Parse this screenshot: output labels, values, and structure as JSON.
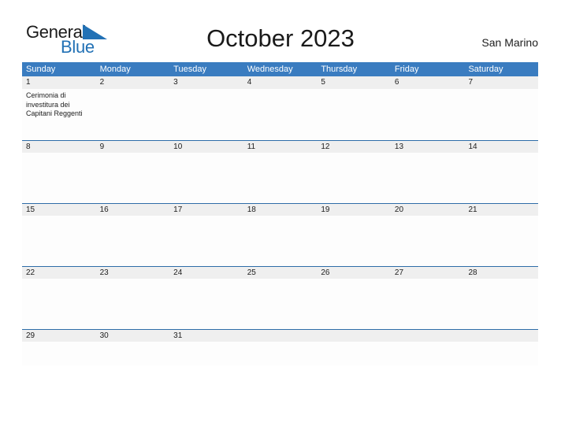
{
  "brand": {
    "name_part1": "General",
    "name_part2": "Blue",
    "logo_icon": "blue-flag-triangle-icon",
    "color_dark": "#1b1b1b",
    "color_blue": "#2271b5"
  },
  "header": {
    "title": "October 2023",
    "location": "San Marino"
  },
  "theme": {
    "header_bar_color": "#3a7cc0",
    "date_band_color": "#efefef",
    "row_divider_color": "#2e6da8",
    "cell_background": "#fdfdfd",
    "text_color": "#202020"
  },
  "calendar": {
    "month": "October",
    "year": "2023",
    "weekday_headers": [
      "Sunday",
      "Monday",
      "Tuesday",
      "Wednesday",
      "Thursday",
      "Friday",
      "Saturday"
    ],
    "weeks": [
      {
        "days": [
          {
            "num": "1",
            "event": "Cerimonia di investitura dei Capitani Reggenti"
          },
          {
            "num": "2",
            "event": ""
          },
          {
            "num": "3",
            "event": ""
          },
          {
            "num": "4",
            "event": ""
          },
          {
            "num": "5",
            "event": ""
          },
          {
            "num": "6",
            "event": ""
          },
          {
            "num": "7",
            "event": ""
          }
        ]
      },
      {
        "days": [
          {
            "num": "8",
            "event": ""
          },
          {
            "num": "9",
            "event": ""
          },
          {
            "num": "10",
            "event": ""
          },
          {
            "num": "11",
            "event": ""
          },
          {
            "num": "12",
            "event": ""
          },
          {
            "num": "13",
            "event": ""
          },
          {
            "num": "14",
            "event": ""
          }
        ]
      },
      {
        "days": [
          {
            "num": "15",
            "event": ""
          },
          {
            "num": "16",
            "event": ""
          },
          {
            "num": "17",
            "event": ""
          },
          {
            "num": "18",
            "event": ""
          },
          {
            "num": "19",
            "event": ""
          },
          {
            "num": "20",
            "event": ""
          },
          {
            "num": "21",
            "event": ""
          }
        ]
      },
      {
        "days": [
          {
            "num": "22",
            "event": ""
          },
          {
            "num": "23",
            "event": ""
          },
          {
            "num": "24",
            "event": ""
          },
          {
            "num": "25",
            "event": ""
          },
          {
            "num": "26",
            "event": ""
          },
          {
            "num": "27",
            "event": ""
          },
          {
            "num": "28",
            "event": ""
          }
        ]
      },
      {
        "days": [
          {
            "num": "29",
            "event": ""
          },
          {
            "num": "30",
            "event": ""
          },
          {
            "num": "31",
            "event": ""
          },
          {
            "num": "",
            "event": ""
          },
          {
            "num": "",
            "event": ""
          },
          {
            "num": "",
            "event": ""
          },
          {
            "num": "",
            "event": ""
          }
        ]
      }
    ]
  }
}
